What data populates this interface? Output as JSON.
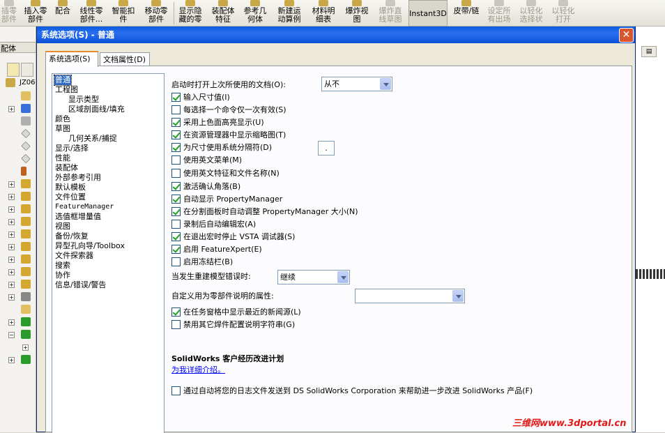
{
  "toolbar": {
    "items": [
      {
        "label": "插零\n部件",
        "disabled": true
      },
      {
        "label": "插入零\n部件",
        "disabled": false
      },
      {
        "label": "配合",
        "disabled": false
      },
      {
        "label": "线性零\n部件...",
        "disabled": false
      },
      {
        "label": "智能扣\n件",
        "disabled": false
      },
      {
        "label": "移动零\n部件",
        "disabled": false
      },
      {
        "label": "显示隐\n藏的零",
        "disabled": false
      },
      {
        "label": "装配体\n特征",
        "disabled": false
      },
      {
        "label": "参考几\n何体",
        "disabled": false
      },
      {
        "label": "新建运\n动算例",
        "disabled": false
      },
      {
        "label": "材料明\n细表",
        "disabled": false
      },
      {
        "label": "爆炸视\n图",
        "disabled": false
      },
      {
        "label": "爆炸直\n线草图",
        "disabled": true
      },
      {
        "label": "Instant3D",
        "disabled": false
      },
      {
        "label": "皮带/链",
        "disabled": false
      },
      {
        "label": "设定所\n有出场",
        "disabled": true
      },
      {
        "label": "以轻化\n选择状",
        "disabled": true
      },
      {
        "label": "以轻化\n打开",
        "disabled": true
      }
    ]
  },
  "left": {
    "tab_label": "配体",
    "root_label": "JZ06"
  },
  "dialog": {
    "title": "系统选项(S) - 普通",
    "close_symbol": "✕",
    "tabs": [
      {
        "label": "系统选项(S)"
      },
      {
        "label": "文档属性(D)"
      }
    ]
  },
  "categories": [
    {
      "label": "普通",
      "selected": true
    },
    {
      "label": "工程图"
    },
    {
      "label": "显示类型"
    },
    {
      "label": "区域剖面线/填充"
    },
    {
      "label": "颜色"
    },
    {
      "label": "草图"
    },
    {
      "label": "几何关系/捕捉"
    },
    {
      "label": "显示/选择"
    },
    {
      "label": "性能"
    },
    {
      "label": "装配体"
    },
    {
      "label": "外部参考引用"
    },
    {
      "label": "默认模板"
    },
    {
      "label": "文件位置"
    },
    {
      "label": "FeatureManager"
    },
    {
      "label": "选值框增量值"
    },
    {
      "label": "视图"
    },
    {
      "label": "备份/恢复"
    },
    {
      "label": "异型孔向导/Toolbox"
    },
    {
      "label": "文件探索器"
    },
    {
      "label": "搜索"
    },
    {
      "label": "协作"
    },
    {
      "label": "信息/错误/警告"
    }
  ],
  "options": {
    "open_last_label": "启动时打开上次所使用的文档(O):",
    "open_last_value": "从不",
    "checkboxes": [
      {
        "label": "输入尺寸值(I)",
        "checked": true
      },
      {
        "label": "每选择一个命令仅一次有效(S)",
        "checked": false
      },
      {
        "label": "采用上色面高亮显示(U)",
        "checked": true
      },
      {
        "label": "在资源管理器中显示缩略图(T)",
        "checked": true
      },
      {
        "label": "为尺寸使用系统分隔符(D)",
        "checked": true
      },
      {
        "label": "使用英文菜单(M)",
        "checked": false
      },
      {
        "label": "使用英文特征和文件名称(N)",
        "checked": false
      },
      {
        "label": "激活确认角落(B)",
        "checked": true
      },
      {
        "label": "自动显示 PropertyManager",
        "checked": true
      },
      {
        "label": "在分割面板时自动调整 PropertyManager 大小(N)",
        "checked": true
      },
      {
        "label": "录制后自动编辑宏(A)",
        "checked": false
      },
      {
        "label": "在退出宏时停止 VSTA 调试器(S)",
        "checked": true
      },
      {
        "label": "启用 FeatureXpert(E)",
        "checked": true
      },
      {
        "label": "启用冻结栏(B)",
        "checked": false
      }
    ],
    "separator_value": ".",
    "rebuild_error_label": "当发生重建模型错误时:",
    "rebuild_error_value": "继续",
    "custom_prop_label": "自定义用为零部件说明的属性:",
    "custom_prop_value": "",
    "checkboxes2": [
      {
        "label": "在任务窗格中显示最近的新闻源(L)",
        "checked": true
      },
      {
        "label": "禁用其它焊件配置说明字符串(G)",
        "checked": false
      }
    ],
    "program_title": "SolidWorks 客户经历改进计划",
    "program_link": "为我详细介绍。",
    "program_checkbox": {
      "label": "通过自动将您的日志文件发送到 DS SolidWorks Corporation 来帮助进一步改进 SolidWorks 产品(F)",
      "checked": false
    }
  },
  "watermark": "三维网www.3dportal.cn",
  "right_button_symbol": "▤"
}
